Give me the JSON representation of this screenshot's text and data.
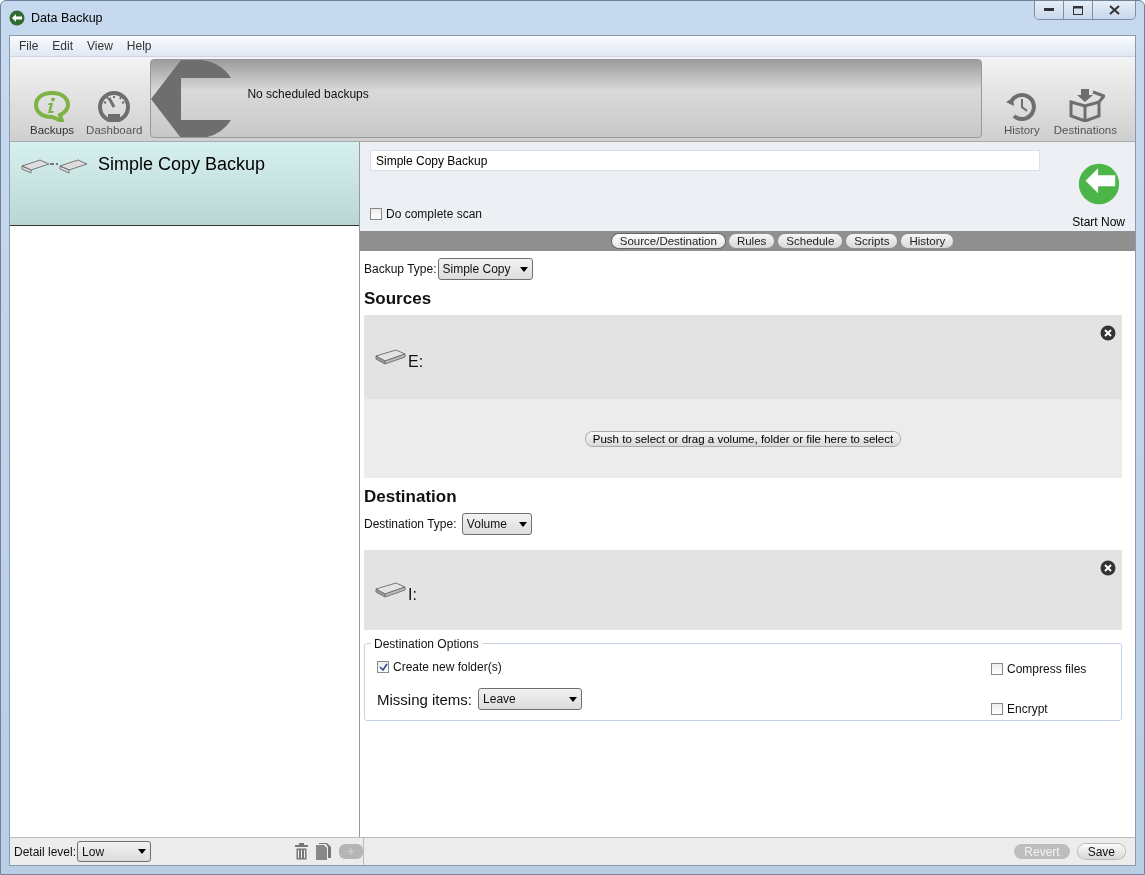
{
  "window": {
    "title": "Data Backup"
  },
  "menu": [
    "File",
    "Edit",
    "View",
    "Help"
  ],
  "toolbar_left": [
    {
      "label": "Backups",
      "kind": "info",
      "selected": true
    },
    {
      "label": "Dashboard",
      "kind": "gauge",
      "selected": false
    }
  ],
  "banner": {
    "text": "No scheduled backups"
  },
  "toolbar_right": [
    {
      "label": "History",
      "kind": "clock",
      "selected": false
    },
    {
      "label": "Destinations",
      "kind": "box",
      "selected": false
    }
  ],
  "sidebar": {
    "items": [
      {
        "label": "Simple Copy Backup",
        "selected": true
      }
    ]
  },
  "footer_left": {
    "detail_label": "Detail level:",
    "detail_value": "Low",
    "add_disabled": true
  },
  "backup": {
    "name": "Simple Copy Backup",
    "complete_scan": {
      "label": "Do complete scan",
      "checked": false
    },
    "start_label": "Start Now"
  },
  "tabs": [
    {
      "label": "Source/Destination",
      "selected": true
    },
    {
      "label": "Rules",
      "selected": false
    },
    {
      "label": "Schedule",
      "selected": false
    },
    {
      "label": "Scripts",
      "selected": false
    },
    {
      "label": "History",
      "selected": false
    }
  ],
  "backup_type": {
    "label": "Backup Type:",
    "value": "Simple Copy"
  },
  "sources": {
    "heading": "Sources",
    "items": [
      "E:"
    ],
    "select_button": "Push to select or drag a volume, folder or file here to select"
  },
  "destination": {
    "heading": "Destination",
    "type_label": "Destination Type:",
    "type_value": "Volume",
    "items": [
      "I:"
    ]
  },
  "destination_options": {
    "title": "Destination Options",
    "create_folders": {
      "label": "Create new folder(s)",
      "checked": true
    },
    "missing_label": "Missing items:",
    "missing_value": "Leave",
    "compress": {
      "label": "Compress files",
      "checked": false
    },
    "encrypt": {
      "label": "Encrypt",
      "checked": false
    }
  },
  "footer_right": [
    {
      "label": "Revert",
      "disabled": true
    },
    {
      "label": "Save",
      "disabled": false
    }
  ]
}
